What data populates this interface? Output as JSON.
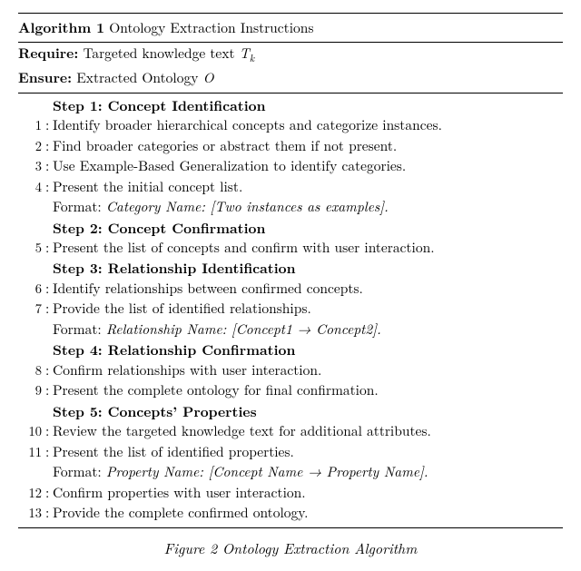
{
  "algo": {
    "number_label": "Algorithm 1",
    "title": "Ontology Extraction Instructions",
    "require_label": "Require:",
    "require_text_a": "Targeted knowledge text ",
    "require_sym_base": "T",
    "require_sym_sub": "k",
    "ensure_label": "Ensure:",
    "ensure_text_a": "Extracted Ontology ",
    "ensure_sym": "O",
    "lines": [
      {
        "n": "",
        "kind": "step",
        "text": "Step 1: Concept Identification"
      },
      {
        "n": "1",
        "kind": "plain",
        "text": "Identify broader hierarchical concepts and categorize instances."
      },
      {
        "n": "2",
        "kind": "plain",
        "text": "Find broader categories or abstract them if not present."
      },
      {
        "n": "3",
        "kind": "plain",
        "text": "Use Example-Based Generalization to identify categories."
      },
      {
        "n": "4",
        "kind": "plain",
        "text": "Present the initial concept list."
      },
      {
        "n": "",
        "kind": "format",
        "prefix": "Format: ",
        "text": "Category Name: [Two instances as examples]."
      },
      {
        "n": "",
        "kind": "step",
        "text": "Step 2: Concept Confirmation"
      },
      {
        "n": "5",
        "kind": "plain",
        "text": "Present the list of concepts and confirm with user interaction."
      },
      {
        "n": "",
        "kind": "step",
        "text": "Step 3: Relationship Identification"
      },
      {
        "n": "6",
        "kind": "plain",
        "text": "Identify relationships between confirmed concepts."
      },
      {
        "n": "7",
        "kind": "plain",
        "text": "Provide the list of identified relationships."
      },
      {
        "n": "",
        "kind": "format",
        "prefix": "Format: ",
        "text": "Relationship Name: [Concept1 → Concept2]."
      },
      {
        "n": "",
        "kind": "step",
        "text": "Step 4: Relationship Confirmation"
      },
      {
        "n": "8",
        "kind": "plain",
        "text": "Confirm relationships with user interaction."
      },
      {
        "n": "9",
        "kind": "plain",
        "text": "Present the complete ontology for final confirmation."
      },
      {
        "n": "",
        "kind": "step",
        "text": "Step 5: Concepts’ Properties"
      },
      {
        "n": "10",
        "kind": "plain",
        "text": "Review the targeted knowledge text for additional attributes."
      },
      {
        "n": "11",
        "kind": "plain",
        "text": "Present the list of identified properties."
      },
      {
        "n": "",
        "kind": "format",
        "prefix": "Format: ",
        "text": "Property Name: [Concept Name → Property Name]."
      },
      {
        "n": "12",
        "kind": "plain",
        "text": "Confirm properties with user interaction."
      },
      {
        "n": "13",
        "kind": "plain",
        "text": "Provide the complete confirmed ontology."
      }
    ]
  },
  "caption": "Figure 2 Ontology Extraction Algorithm"
}
